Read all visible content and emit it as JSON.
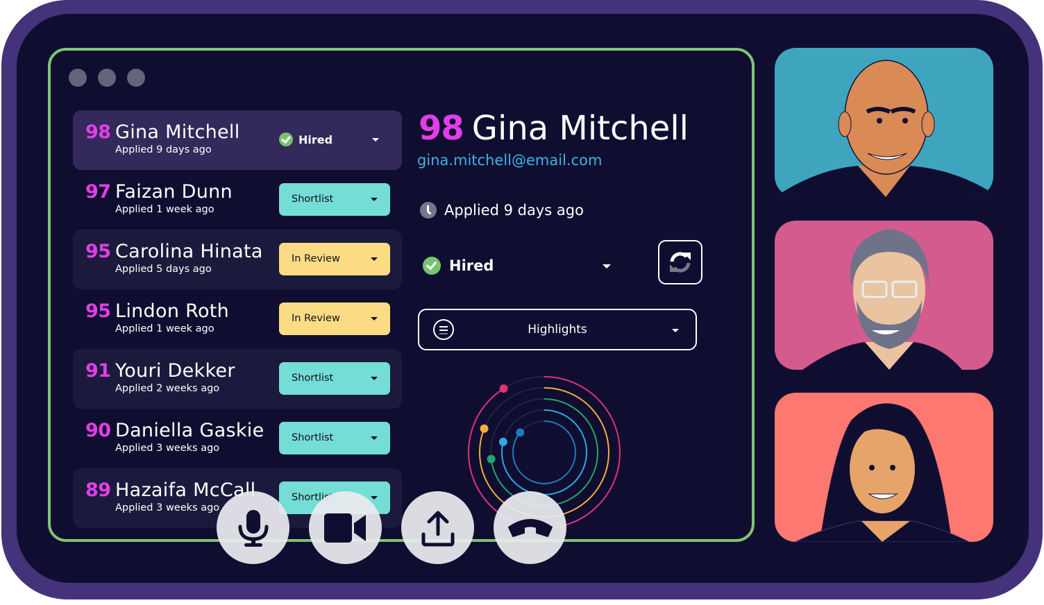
{
  "window": {
    "dots": [
      "window-dot-1",
      "window-dot-2",
      "window-dot-3"
    ]
  },
  "candidates": [
    {
      "score": "98",
      "name": "Gina Mitchell",
      "applied": "Applied 9 days ago",
      "status": "Hired",
      "status_type": "hired",
      "row_style": "active"
    },
    {
      "score": "97",
      "name": "Faizan Dunn",
      "applied": "Applied 1 week ago",
      "status": "Shortlist",
      "status_type": "shortlist",
      "row_style": "plain"
    },
    {
      "score": "95",
      "name": "Carolina Hinata",
      "applied": "Applied 5 days ago",
      "status": "In Review",
      "status_type": "review",
      "row_style": "alt"
    },
    {
      "score": "95",
      "name": "Lindon Roth",
      "applied": "Applied 1 week ago",
      "status": "In Review",
      "status_type": "review",
      "row_style": "plain"
    },
    {
      "score": "91",
      "name": "Youri Dekker",
      "applied": "Applied 2 weeks ago",
      "status": "Shortlist",
      "status_type": "shortlist",
      "row_style": "alt"
    },
    {
      "score": "90",
      "name": "Daniella Gaskie",
      "applied": "Applied 3 weeks ago",
      "status": "Shortlist",
      "status_type": "shortlist",
      "row_style": "plain"
    },
    {
      "score": "89",
      "name": "Hazaifa McCall",
      "applied": "Applied 3 weeks ago",
      "status": "Shortlist",
      "status_type": "shortlist",
      "row_style": "alt"
    }
  ],
  "detail": {
    "score": "98",
    "name": "Gina Mitchell",
    "email": "gina.mitchell@email.com",
    "applied": "Applied 9 days ago",
    "status": "Hired",
    "highlights_label": "Highlights",
    "refresh_icon": "refresh-icon",
    "menu_icon": "menu-icon"
  },
  "progress_rings": [
    {
      "name": "ring-pink",
      "color": "#e0317b",
      "progress": 0.91
    },
    {
      "name": "ring-orange",
      "color": "#f6ad3c",
      "progress": 0.81
    },
    {
      "name": "ring-green",
      "color": "#21a66b",
      "progress": 0.73
    },
    {
      "name": "ring-lightblue",
      "color": "#2aaae2",
      "progress": 0.79
    },
    {
      "name": "ring-blue",
      "color": "#1f79bd",
      "progress": 0.86
    }
  ],
  "call_controls": [
    {
      "name": "microphone-button",
      "icon": "microphone-icon"
    },
    {
      "name": "camera-button",
      "icon": "video-camera-icon"
    },
    {
      "name": "share-screen-button",
      "icon": "upload-icon"
    },
    {
      "name": "end-call-button",
      "icon": "hang-up-icon"
    }
  ],
  "participants": [
    {
      "name": "participant-1",
      "bg": "#3fa5bf"
    },
    {
      "name": "participant-2",
      "bg": "#d35b8e"
    },
    {
      "name": "participant-3",
      "bg": "#fd7870"
    }
  ],
  "colors": {
    "frame": "#44327a",
    "screen": "#100e30",
    "window_border": "#80c473",
    "score": "#e23ee8",
    "email": "#3fb2e3",
    "shortlist": "#74ddd6",
    "review": "#fbdc85",
    "hired_check": "#7ac36e"
  }
}
